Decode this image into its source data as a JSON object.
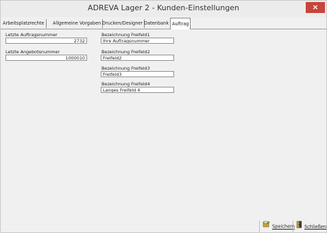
{
  "window": {
    "title": "ADREVA Lager 2 - Kunden-Einstellungen",
    "close_label": "×"
  },
  "tabs": [
    {
      "label": "Arbeitsplatzrechte"
    },
    {
      "label": "Allgemeine Vorgaben"
    },
    {
      "label": "Drucken/Designer"
    },
    {
      "label": "Datenbank"
    },
    {
      "label": "Auftrag"
    }
  ],
  "form": {
    "auftragsnummer_label": "Letzte Auftragsnummer",
    "auftragsnummer_value": "2732",
    "angebotsnummer_label": "Letzte Angebotsnummer",
    "angebotsnummer_value": "1000010",
    "freifeld1_label": "Bezeichnung Freifeld1",
    "freifeld1_value": "Ihre Auftragsnummer",
    "freifeld2_label": "Bezeichnung Freifeld2",
    "freifeld2_value": "Freifeld2",
    "freifeld3_label": "Bezeichnung Freifeld3",
    "freifeld3_value": "Freifeld3",
    "freifeld4_label": "Bezeichnung Freifeld4",
    "freifeld4_value": "Langes Freifeld 4"
  },
  "buttons": {
    "save_label": "Speichern",
    "close_label": "Schließen"
  },
  "icons": {
    "save": "save-icon",
    "close": "exit-door-icon"
  }
}
